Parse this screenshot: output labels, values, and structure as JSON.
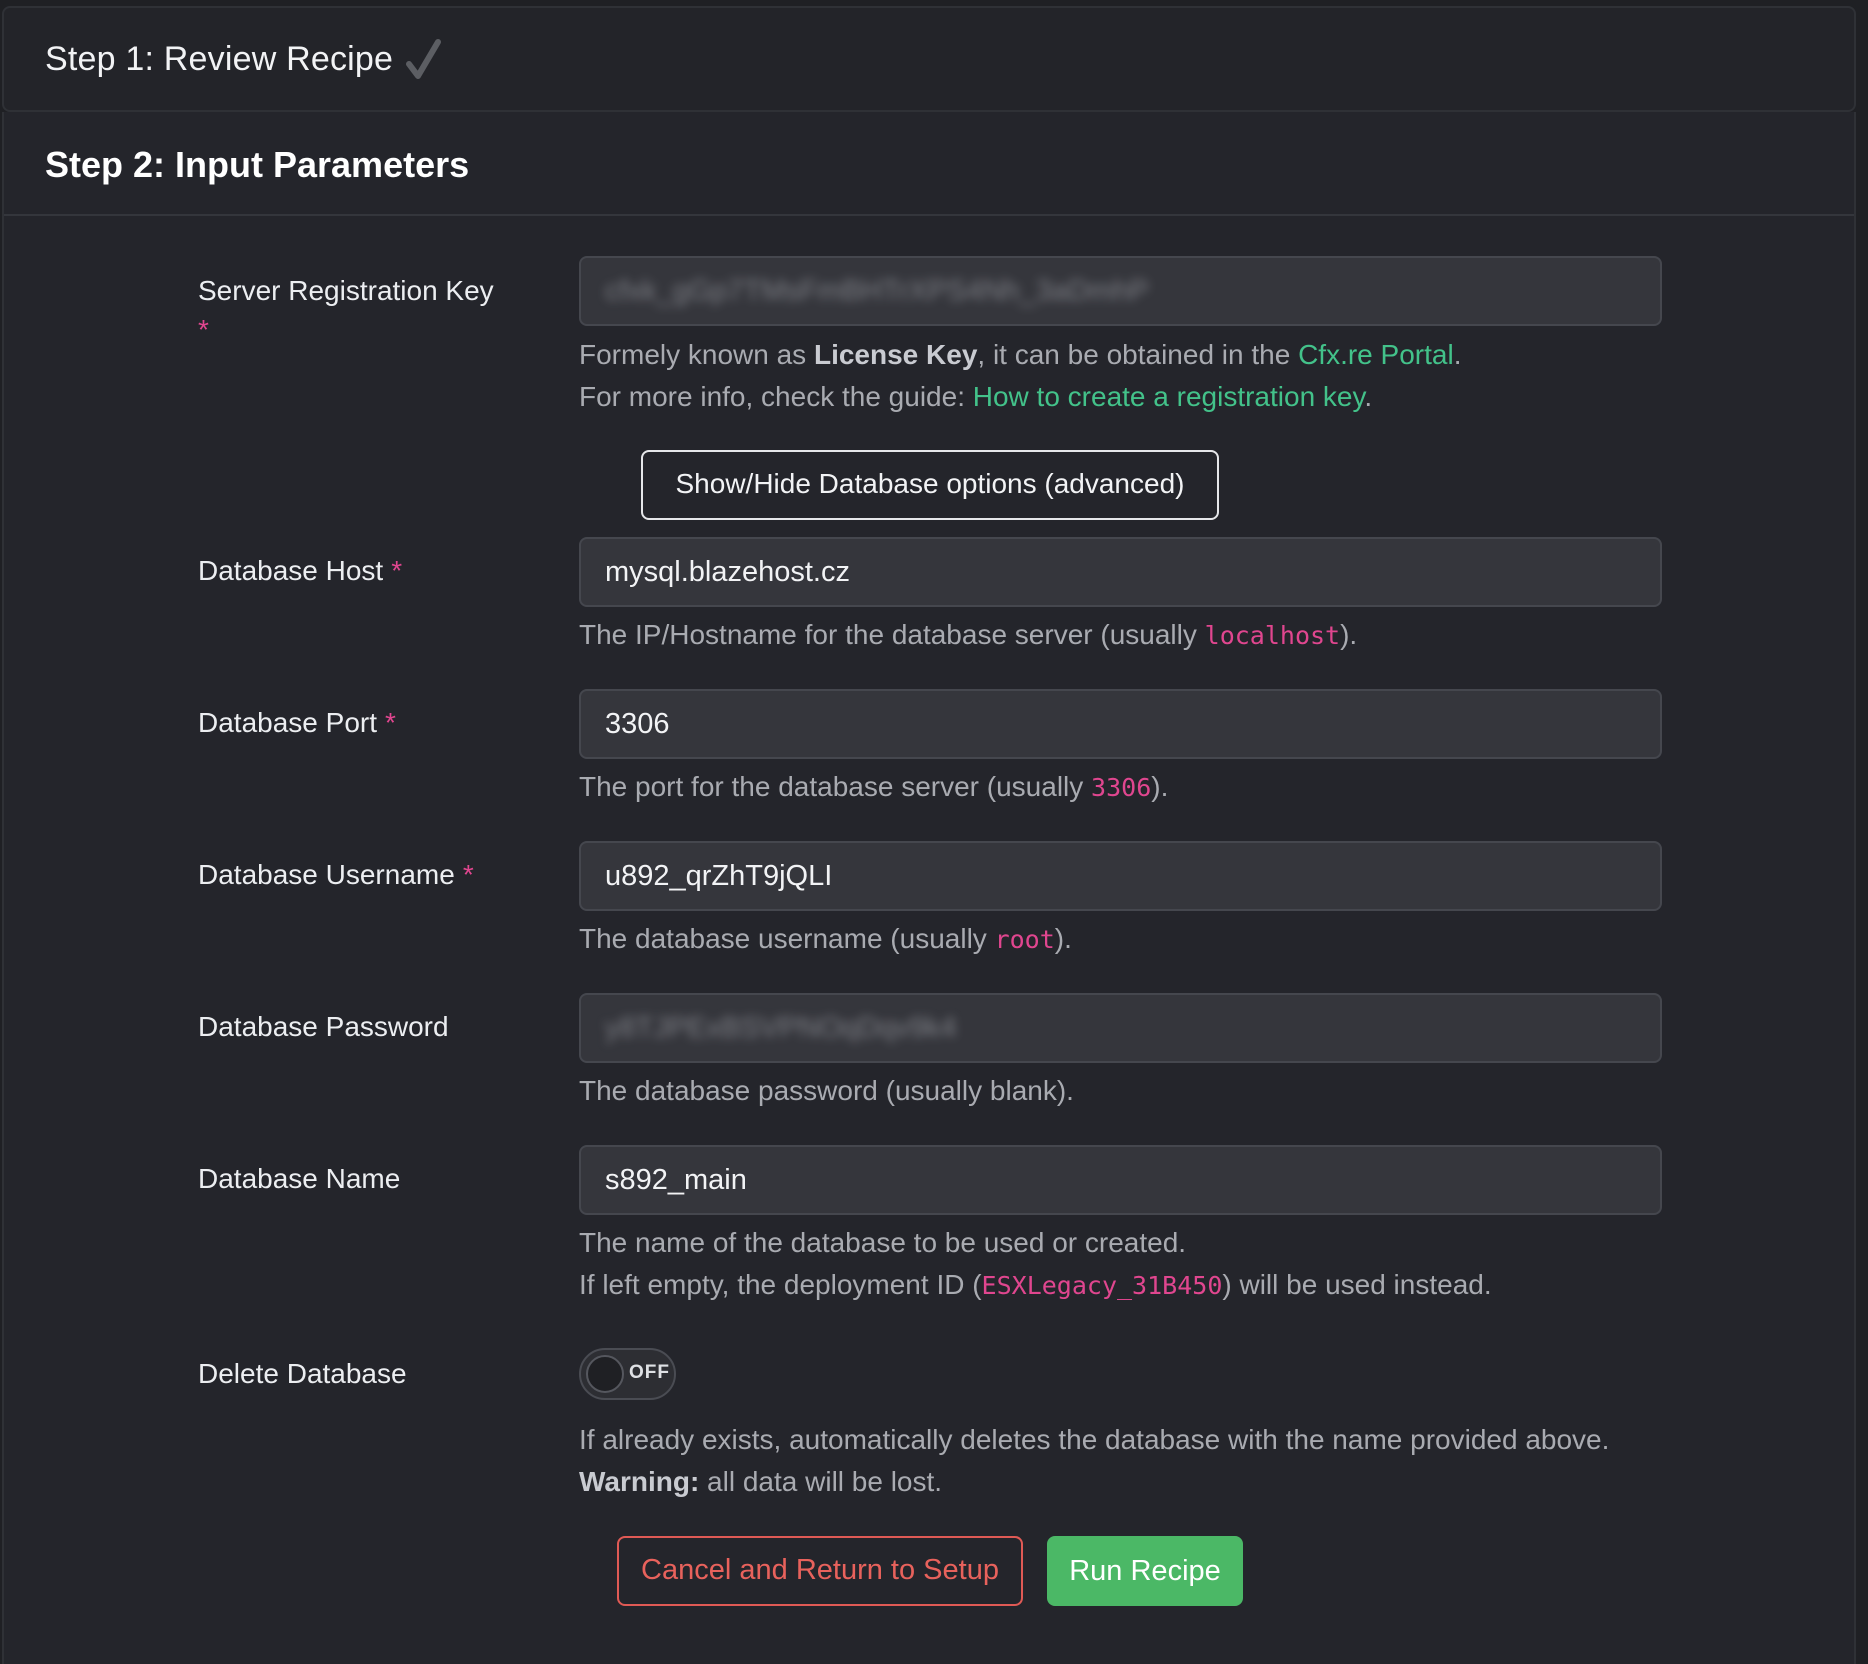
{
  "step1": {
    "title": "Step 1: Review Recipe",
    "icon": "checkmark-icon"
  },
  "step2": {
    "title": "Step 2: Input Parameters"
  },
  "required_marker": "*",
  "fields": {
    "registration_key": {
      "label": "Server Registration Key",
      "value": "cfxk_gGp7TMsFmBHTrXPS4Nh_3aDmhP",
      "help_line1_pre": "Formely known as ",
      "help_line1_bold": "License Key",
      "help_line1_mid": ", it can be obtained in the ",
      "help_line1_link": "Cfx.re Portal",
      "help_line1_post": ".",
      "help_line2_pre": "For more info, check the guide: ",
      "help_line2_link": "How to create a registration key",
      "help_line2_post": "."
    },
    "db_host": {
      "label": "Database Host",
      "value": "mysql.blazehost.cz",
      "help_pre": "The IP/Hostname for the database server (usually ",
      "help_code": "localhost",
      "help_post": ")."
    },
    "db_port": {
      "label": "Database Port",
      "value": "3306",
      "help_pre": "The port for the database server (usually ",
      "help_code": "3306",
      "help_post": ")."
    },
    "db_username": {
      "label": "Database Username",
      "value": "u892_qrZhT9jQLI",
      "help_pre": "The database username (usually ",
      "help_code": "root",
      "help_post": ")."
    },
    "db_password": {
      "label": "Database Password",
      "value": "y8TJPExBSVPNOqDqv9k4",
      "help": "The database password (usually blank)."
    },
    "db_name": {
      "label": "Database Name",
      "value": "s892_main",
      "help_line1": "The name of the database to be used or created.",
      "help_line2_pre": "If left empty, the deployment ID (",
      "help_line2_code": "ESXLegacy_31B450",
      "help_line2_post": ") will be used instead."
    },
    "delete_db": {
      "label": "Delete Database",
      "state": "OFF",
      "help_line1": "If already exists, automatically deletes the database with the name provided above.",
      "help_line2_bold": "Warning:",
      "help_line2_post": " all data will be lost."
    }
  },
  "buttons": {
    "toggle_db_options": "Show/Hide Database options (advanced)",
    "cancel": "Cancel and Return to Setup",
    "run": "Run Recipe"
  },
  "colors": {
    "background": "#1f2024",
    "input_bg": "#35363c",
    "required": "#e0468f",
    "link": "#43c28a",
    "code": "#e0468f",
    "cancel": "#e05a55",
    "run": "#4bb866"
  }
}
